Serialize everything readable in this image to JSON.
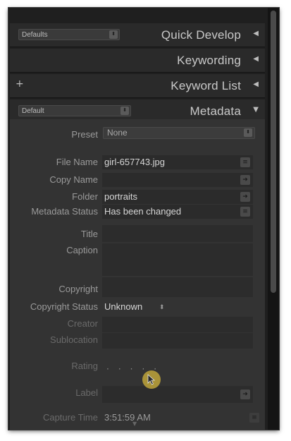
{
  "panels": {
    "quick_develop": {
      "title": "Quick Develop",
      "preset": "Defaults"
    },
    "keywording": {
      "title": "Keywording"
    },
    "keyword_list": {
      "title": "Keyword List",
      "add": "+"
    },
    "metadata": {
      "title": "Metadata",
      "preset": "Default"
    }
  },
  "metadata": {
    "preset": {
      "label": "Preset",
      "value": "None"
    },
    "file_name": {
      "label": "File Name",
      "value": "girl-657743.jpg"
    },
    "copy_name": {
      "label": "Copy Name",
      "value": ""
    },
    "folder": {
      "label": "Folder",
      "value": "portraits"
    },
    "metadata_status": {
      "label": "Metadata Status",
      "value": "Has been changed"
    },
    "title": {
      "label": "Title"
    },
    "caption": {
      "label": "Caption"
    },
    "copyright": {
      "label": "Copyright"
    },
    "copyright_status": {
      "label": "Copyright Status",
      "value": "Unknown"
    },
    "creator": {
      "label": "Creator"
    },
    "sublocation": {
      "label": "Sublocation"
    },
    "rating": {
      "label": "Rating",
      "stars": 0
    },
    "label": {
      "label": "Label"
    },
    "capture_time": {
      "label": "Capture Time",
      "value": "3:51:59 AM"
    }
  },
  "icons": {
    "collapsed": "triangle-left-icon",
    "expanded": "triangle-down-icon",
    "spinner": "updown-spinner-icon",
    "go_to": "arrow-right-icon",
    "list": "list-icon"
  },
  "colors": {
    "panel_bg": "#333333",
    "header_bg": "#2a2a2a",
    "cursor_highlight": "#d2b43c"
  }
}
